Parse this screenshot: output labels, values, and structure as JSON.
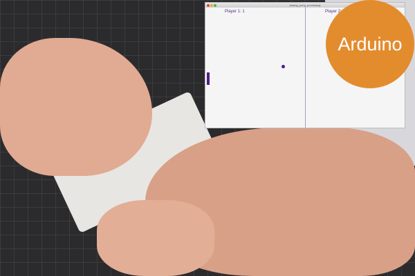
{
  "window": {
    "title": "analog_pong_processing"
  },
  "game": {
    "player1_score": "Player 1: 1",
    "player2_score": "Player 2: 1",
    "paddle_color": "#4b1f85"
  },
  "badge": {
    "label": "Arduino",
    "color": "#e38c2e"
  }
}
